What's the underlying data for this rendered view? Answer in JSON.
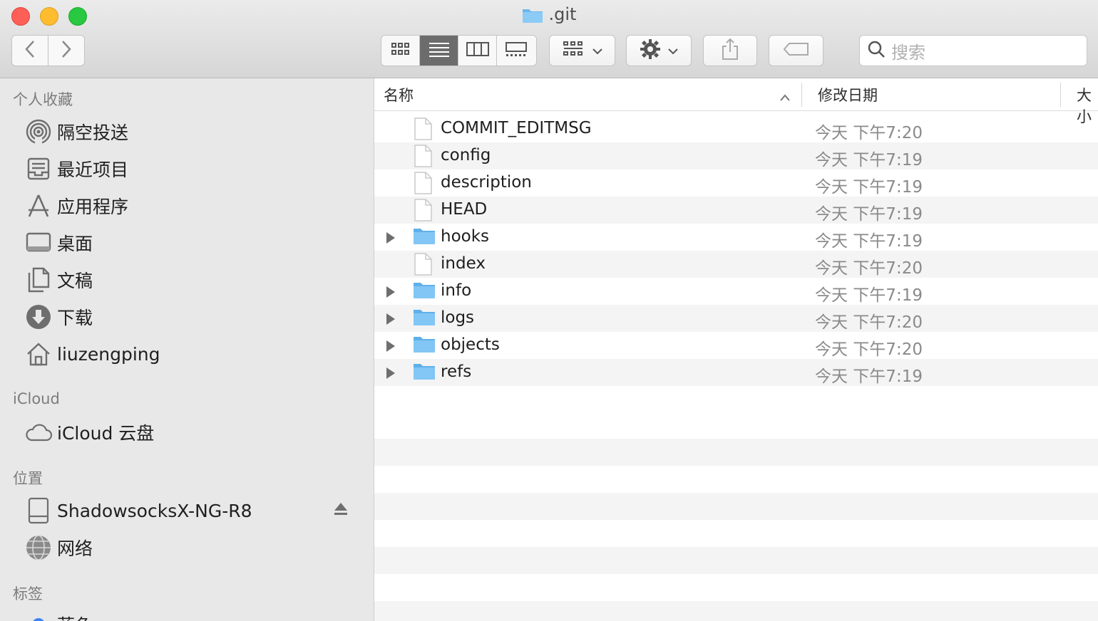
{
  "window": {
    "title": ".git"
  },
  "toolbar": {
    "back_icon": "chevron-left-icon",
    "forward_icon": "chevron-right-icon",
    "view_modes": [
      "icon-view",
      "list-view",
      "column-view",
      "gallery-view"
    ],
    "active_view": "list-view",
    "search_placeholder": "搜索"
  },
  "sidebar": {
    "sections": [
      {
        "header": "个人收藏",
        "items": [
          {
            "label": "隔空投送",
            "icon": "airdrop-icon"
          },
          {
            "label": "最近项目",
            "icon": "recents-icon"
          },
          {
            "label": "应用程序",
            "icon": "applications-icon"
          },
          {
            "label": "桌面",
            "icon": "desktop-icon"
          },
          {
            "label": "文稿",
            "icon": "documents-icon"
          },
          {
            "label": "下载",
            "icon": "downloads-icon"
          },
          {
            "label": "liuzengping",
            "icon": "home-icon"
          }
        ]
      },
      {
        "header": "iCloud",
        "items": [
          {
            "label": "iCloud 云盘",
            "icon": "icloud-icon"
          }
        ]
      },
      {
        "header": "位置",
        "items": [
          {
            "label": "ShadowsocksX-NG-R8",
            "icon": "drive-icon"
          },
          {
            "label": "网络",
            "icon": "network-icon"
          }
        ]
      },
      {
        "header": "标签",
        "items": [
          {
            "label": "蓝色",
            "icon": "blue-tag-icon"
          }
        ]
      }
    ]
  },
  "columns": {
    "name": "名称",
    "modified": "修改日期",
    "size": "大小"
  },
  "files": [
    {
      "name": "COMMIT_EDITMSG",
      "date": "今天 下午7:20",
      "type": "file"
    },
    {
      "name": "config",
      "date": "今天 下午7:19",
      "type": "file"
    },
    {
      "name": "description",
      "date": "今天 下午7:19",
      "type": "file"
    },
    {
      "name": "HEAD",
      "date": "今天 下午7:19",
      "type": "file"
    },
    {
      "name": "hooks",
      "date": "今天 下午7:19",
      "type": "folder"
    },
    {
      "name": "index",
      "date": "今天 下午7:20",
      "type": "file"
    },
    {
      "name": "info",
      "date": "今天 下午7:19",
      "type": "folder"
    },
    {
      "name": "logs",
      "date": "今天 下午7:20",
      "type": "folder"
    },
    {
      "name": "objects",
      "date": "今天 下午7:20",
      "type": "folder"
    },
    {
      "name": "refs",
      "date": "今天 下午7:19",
      "type": "folder"
    }
  ]
}
